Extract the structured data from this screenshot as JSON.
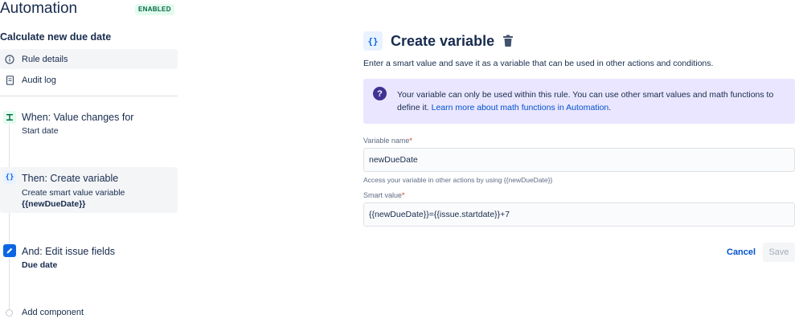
{
  "app": {
    "title": "Automation",
    "status_badge": "ENABLED"
  },
  "rule": {
    "name": "Calculate new due date"
  },
  "sidebar": {
    "items": [
      {
        "label": "Rule details",
        "icon": "info-icon"
      },
      {
        "label": "Audit log",
        "icon": "document-icon"
      }
    ]
  },
  "steps": [
    {
      "title": "When: Value changes for",
      "sub": "Start date",
      "icon": "trigger-icon"
    },
    {
      "title": "Then: Create variable",
      "sub": "Create smart value variable",
      "sub2": "{{newDueDate}}",
      "icon": "variable-icon",
      "icon_text": "{}"
    },
    {
      "title": "And: Edit issue fields",
      "sub2": "Due date",
      "icon": "pencil-icon"
    }
  ],
  "add_component": {
    "label": "Add component"
  },
  "panel": {
    "icon_text": "{}",
    "title": "Create variable",
    "description": "Enter a smart value and save it as a variable that can be used in other actions and conditions.",
    "info": {
      "icon_text": "?",
      "text": "Your variable can only be used within this rule. You can use other smart values and math functions to define it. ",
      "link": "Learn more about math functions in Automation",
      "suffix": "."
    },
    "variable_name": {
      "label": "Variable name",
      "required": "*",
      "value": "newDueDate",
      "helper": "Access your variable in other actions by using {{newDueDate}}"
    },
    "smart_value": {
      "label": "Smart value",
      "required": "*",
      "value": "{{newDueDate}}={{issue.startdate}}+7"
    },
    "buttons": {
      "cancel": "Cancel",
      "save": "Save"
    }
  },
  "colors": {
    "accent": "#0052cc",
    "enabled_bg": "#e3fcef",
    "enabled_text": "#006644",
    "info_bg": "#eae6ff",
    "info_icon": "#403294",
    "trigger_icon_bg": "#e3fcef",
    "variable_icon_bg": "#e9f2ff",
    "action_icon_bg": "#0c66e4"
  }
}
